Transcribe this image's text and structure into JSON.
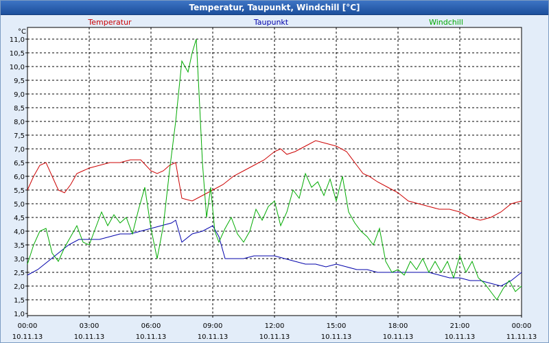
{
  "window": {
    "title": "Temperatur, Taupunkt, Windchill [°C]"
  },
  "chart_data": {
    "type": "line",
    "title": "Temperatur, Taupunkt, Windchill [°C]",
    "ylabel": "°C",
    "xlabel": "",
    "ylim": [
      1.0,
      11.5
    ],
    "xlim": [
      0,
      24
    ],
    "grid": true,
    "legend_position": "top",
    "y_ticks": [
      "1,0",
      "1,5",
      "2,0",
      "2,5",
      "3,0",
      "3,5",
      "4,0",
      "4,5",
      "5,0",
      "5,5",
      "6,0",
      "6,5",
      "7,0",
      "7,5",
      "8,0",
      "8,5",
      "9,0",
      "9,5",
      "10,0",
      "10,5",
      "11,0"
    ],
    "x_ticks": [
      {
        "time": "00:00",
        "date": "10.11.13"
      },
      {
        "time": "03:00",
        "date": "10.11.13"
      },
      {
        "time": "06:00",
        "date": "10.11.13"
      },
      {
        "time": "09:00",
        "date": "10.11.13"
      },
      {
        "time": "12:00",
        "date": "10.11.13"
      },
      {
        "time": "15:00",
        "date": "10.11.13"
      },
      {
        "time": "18:00",
        "date": "10.11.13"
      },
      {
        "time": "21:00",
        "date": "10.11.13"
      },
      {
        "time": "00:00",
        "date": "11.11.13"
      }
    ],
    "series": [
      {
        "name": "Temperatur",
        "color": "#cc0000",
        "x": [
          0,
          0.3,
          0.6,
          0.9,
          1.2,
          1.5,
          1.8,
          2.1,
          2.4,
          2.7,
          3,
          3.5,
          4,
          4.5,
          5,
          5.5,
          6,
          6.3,
          6.6,
          6.9,
          7.2,
          7.5,
          8,
          8.5,
          9,
          9.5,
          10,
          10.5,
          11,
          11.5,
          12,
          12.3,
          12.6,
          13,
          13.5,
          14,
          14.5,
          15,
          15.5,
          16,
          16.3,
          16.6,
          17,
          17.5,
          18,
          18.5,
          19,
          19.5,
          20,
          20.5,
          21,
          21.5,
          22,
          22.5,
          23,
          23.5,
          24
        ],
        "y": [
          5.5,
          6.0,
          6.4,
          6.5,
          6.0,
          5.5,
          5.4,
          5.7,
          6.1,
          6.2,
          6.3,
          6.4,
          6.5,
          6.5,
          6.6,
          6.6,
          6.2,
          6.1,
          6.2,
          6.4,
          6.5,
          5.2,
          5.1,
          5.3,
          5.5,
          5.7,
          6.0,
          6.2,
          6.4,
          6.6,
          6.9,
          7.0,
          6.8,
          6.9,
          7.1,
          7.3,
          7.2,
          7.1,
          6.9,
          6.4,
          6.1,
          6.0,
          5.8,
          5.6,
          5.4,
          5.1,
          5.0,
          4.9,
          4.8,
          4.8,
          4.7,
          4.5,
          4.4,
          4.5,
          4.7,
          5.0,
          5.1
        ]
      },
      {
        "name": "Taupunkt",
        "color": "#0000aa",
        "x": [
          0,
          0.5,
          1,
          1.5,
          2,
          2.5,
          3,
          3.5,
          4,
          4.5,
          5,
          5.5,
          6,
          6.5,
          7,
          7.2,
          7.5,
          8,
          8.5,
          9,
          9.3,
          9.6,
          10,
          10.5,
          11,
          11.5,
          12,
          12.5,
          13,
          13.5,
          14,
          14.5,
          15,
          15.5,
          16,
          16.5,
          17,
          17.5,
          18,
          18.5,
          19,
          19.5,
          20,
          20.5,
          21,
          21.5,
          22,
          22.5,
          23,
          23.5,
          24
        ],
        "y": [
          2.4,
          2.6,
          2.9,
          3.2,
          3.5,
          3.7,
          3.7,
          3.7,
          3.8,
          3.9,
          3.9,
          4.0,
          4.1,
          4.2,
          4.3,
          4.4,
          3.6,
          3.9,
          4.0,
          4.2,
          3.8,
          3.0,
          3.0,
          3.0,
          3.1,
          3.1,
          3.1,
          3.0,
          2.9,
          2.8,
          2.8,
          2.7,
          2.8,
          2.7,
          2.6,
          2.6,
          2.5,
          2.5,
          2.5,
          2.5,
          2.5,
          2.5,
          2.4,
          2.3,
          2.3,
          2.2,
          2.2,
          2.1,
          2.0,
          2.2,
          2.5
        ]
      },
      {
        "name": "Windchill",
        "color": "#00aa00",
        "x": [
          0,
          0.3,
          0.6,
          0.9,
          1.2,
          1.5,
          1.8,
          2.1,
          2.4,
          2.7,
          3,
          3.3,
          3.6,
          3.9,
          4.2,
          4.5,
          4.8,
          5.1,
          5.4,
          5.7,
          6,
          6.3,
          6.6,
          6.9,
          7.2,
          7.5,
          7.8,
          8,
          8.2,
          8.35,
          8.5,
          8.7,
          8.9,
          9.1,
          9.3,
          9.6,
          9.9,
          10.2,
          10.5,
          10.8,
          11.1,
          11.4,
          11.7,
          12,
          12.3,
          12.6,
          12.9,
          13.2,
          13.5,
          13.8,
          14.1,
          14.4,
          14.7,
          15,
          15.3,
          15.6,
          15.9,
          16.2,
          16.5,
          16.8,
          17.1,
          17.4,
          17.7,
          18,
          18.3,
          18.6,
          18.9,
          19.2,
          19.5,
          19.8,
          20.1,
          20.4,
          20.7,
          21,
          21.3,
          21.6,
          21.9,
          22.2,
          22.5,
          22.8,
          23.1,
          23.4,
          23.7,
          24
        ],
        "y": [
          2.8,
          3.5,
          4.0,
          4.1,
          3.2,
          2.9,
          3.4,
          3.8,
          4.2,
          3.6,
          3.5,
          4.1,
          4.7,
          4.2,
          4.6,
          4.3,
          4.5,
          3.9,
          4.8,
          5.6,
          4.1,
          3.0,
          4.2,
          6.2,
          8.0,
          10.2,
          9.8,
          10.5,
          11.0,
          8.8,
          6.5,
          4.5,
          5.6,
          4.0,
          3.6,
          4.1,
          4.5,
          3.9,
          3.6,
          4.0,
          4.8,
          4.4,
          4.9,
          5.1,
          4.2,
          4.7,
          5.5,
          5.2,
          6.1,
          5.6,
          5.8,
          5.3,
          5.9,
          5.1,
          6.0,
          4.7,
          4.3,
          4.0,
          3.8,
          3.5,
          4.1,
          2.9,
          2.5,
          2.6,
          2.4,
          2.9,
          2.6,
          3.0,
          2.5,
          2.9,
          2.5,
          2.9,
          2.3,
          3.1,
          2.5,
          2.9,
          2.3,
          2.1,
          1.8,
          1.5,
          1.9,
          2.2,
          1.8,
          2.0
        ]
      }
    ]
  }
}
